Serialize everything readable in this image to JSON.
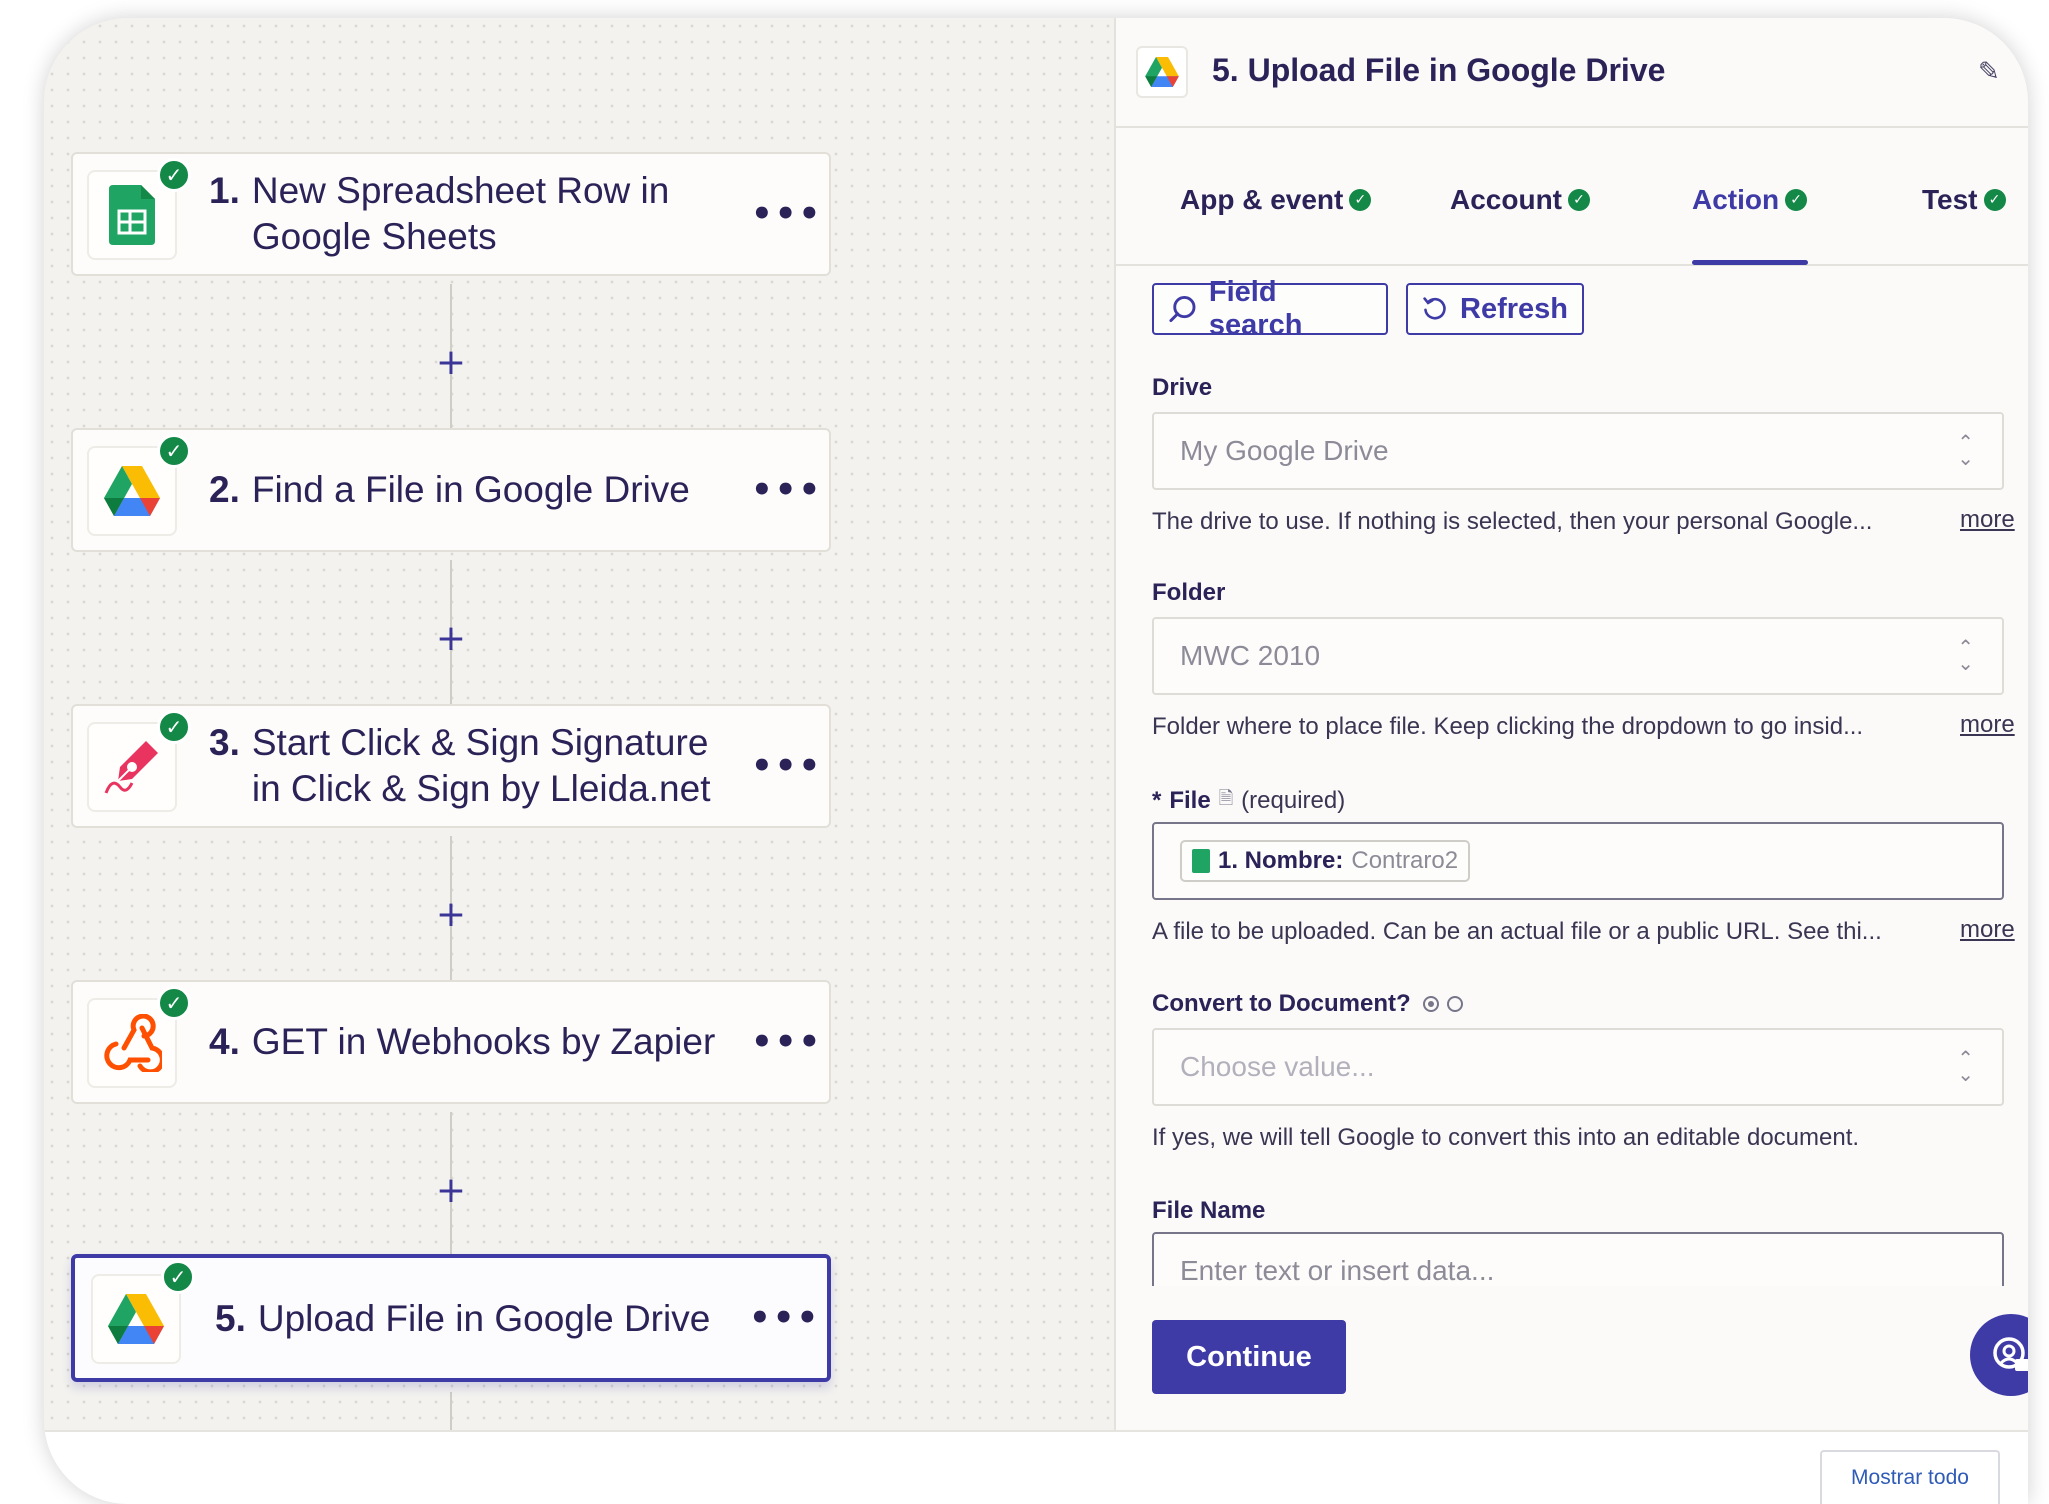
{
  "workflow": {
    "steps": [
      {
        "number": "1.",
        "title": "New Spreadsheet Row in Google Sheets",
        "icon": "google-sheets-icon"
      },
      {
        "number": "2.",
        "title": "Find a File in Google Drive",
        "icon": "google-drive-icon"
      },
      {
        "number": "3.",
        "title": "Start Click & Sign Signature in Click & Sign by Lleida.net",
        "icon": "click-sign-icon"
      },
      {
        "number": "4.",
        "title": "GET in Webhooks by Zapier",
        "icon": "webhook-icon"
      },
      {
        "number": "5.",
        "title": "Upload File in Google Drive",
        "icon": "google-drive-icon"
      }
    ],
    "more_glyph": "•••",
    "add_glyph": "+",
    "check_glyph": "✓"
  },
  "panel": {
    "title": "5. Upload File in Google Drive",
    "tabs": [
      {
        "label": "App & event"
      },
      {
        "label": "Account"
      },
      {
        "label": "Action"
      },
      {
        "label": "Test"
      }
    ],
    "active_tab": "Action",
    "field_search_label": "Field search",
    "refresh_label": "Refresh",
    "drive": {
      "label": "Drive",
      "value": "My Google Drive",
      "help": "The drive to use. If nothing is selected, then your personal Google...",
      "more": "more"
    },
    "folder": {
      "label": "Folder",
      "value": "MWC 2010",
      "help": "Folder where to place file. Keep clicking the dropdown to go insid...",
      "more": "more"
    },
    "file": {
      "required_mark": "*",
      "label": "File",
      "required_text": "(required)",
      "chip_key": "1. Nombre:",
      "chip_value": "Contraro2",
      "help": "A file to be uploaded. Can be an actual file or a public URL. See thi...",
      "more": "more"
    },
    "convert": {
      "label": "Convert to Document?",
      "placeholder": "Choose value...",
      "help": "If yes, we will tell Google to convert this into an editable document."
    },
    "file_name": {
      "label": "File Name",
      "placeholder": "Enter text or insert data..."
    },
    "continue_label": "Continue"
  },
  "footer": {
    "show_all_label": "Mostrar todo"
  },
  "colors": {
    "accent": "#3e3aa6",
    "success": "#138847"
  }
}
